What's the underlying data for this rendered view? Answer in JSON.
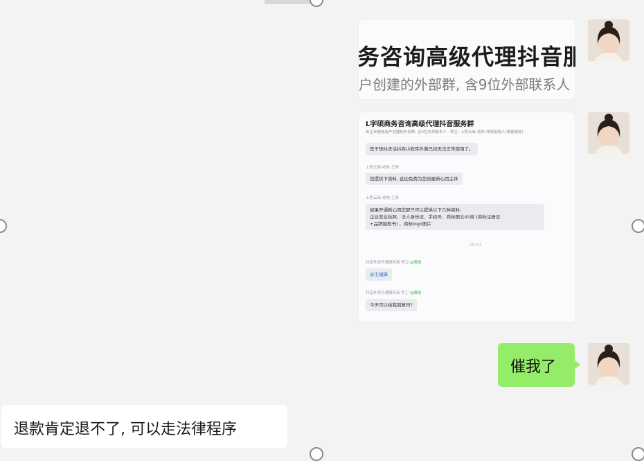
{
  "chat": {
    "image1": {
      "title": "务咨询高级代理抖音服",
      "subtitle": "户创建的外部群, 含9位外部联系人"
    },
    "image2": {
      "title": "L字硕商务咨询高级代理抖音服务群",
      "subtitle": "由企业微信用户创建的外部群, 含9位外部联系人 · 群主: 上势云商-老陈-伴随陪跑人(泰鑫微信)",
      "msg1": "签于快抖去话抖商小程序外黄已扣无法正常使用了。",
      "sender2": "上势云商-老陈-王哥",
      "msg2": "您提供下资料, 这边免费为您创建新心团主体",
      "sender3": "上势云商-老陈-王哥",
      "msg3_line1": "如果开通新心团您那只可以提供以下几种资料:",
      "msg3_line2": "企业营业执照、法人身份证、手机号、商标图文43类 (商标注册证",
      "msg3_line3": "+品牌授权书) 、商标logo图片",
      "time": "10:41",
      "sender4": "抖音外卖开通服务商 李卫",
      "sender4_tag": "@微信",
      "msg4": "@王福锋",
      "sender5": "抖音外卖开通服务商 李卫",
      "sender5_tag": "@微信",
      "msg5": "今天可以给我回复吗?"
    },
    "sent_text": "催我了",
    "received_text": "退款肯定退不了, 可以走法律程序"
  },
  "colors": {
    "background": "#f3f3f3",
    "sent_bubble": "#95ec69",
    "received_bubble": "#ffffff"
  },
  "icons": [
    "avatar-icon"
  ]
}
